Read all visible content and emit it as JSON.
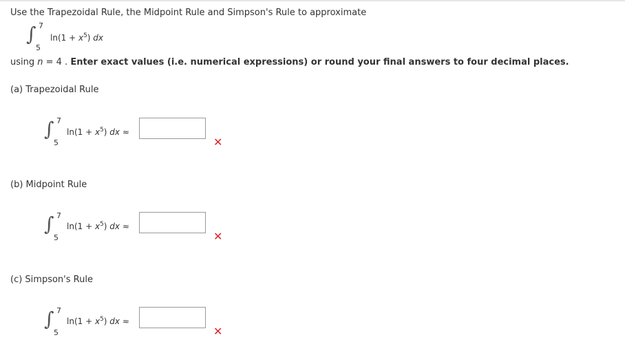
{
  "intro": "Use the Trapezoidal Rule, the Midpoint Rule and Simpson's Rule to approximate",
  "integral": {
    "upper": "7",
    "lower": "5",
    "integrand_pre": "ln(1 + ",
    "var": "x",
    "exp": "5",
    "integrand_post": ") ",
    "dx": "dx",
    "approx": "≈"
  },
  "using": {
    "prefix": "using ",
    "n_var": "n",
    "n_eq": " = 4 . ",
    "bold": "Enter exact values (i.e. numerical expressions) or round your final answers to four decimal places."
  },
  "parts": [
    {
      "label": "(a) Trapezoidal Rule",
      "value": "",
      "status": "✕"
    },
    {
      "label": "(b) Midpoint Rule",
      "value": "",
      "status": "✕"
    },
    {
      "label": "(c) Simpson's Rule",
      "value": "",
      "status": "✕"
    }
  ],
  "colors": {
    "incorrect": "#d9262b"
  }
}
